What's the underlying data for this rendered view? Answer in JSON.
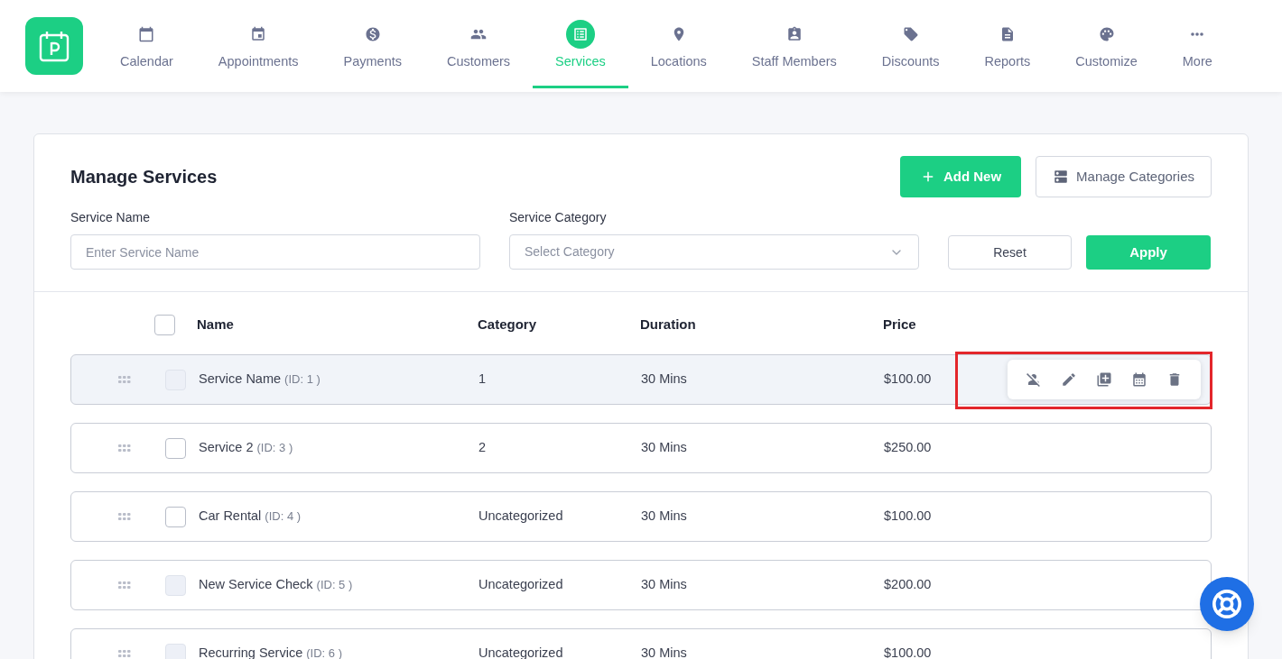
{
  "nav": {
    "items": [
      {
        "label": "Calendar",
        "selected": false
      },
      {
        "label": "Appointments",
        "selected": false
      },
      {
        "label": "Payments",
        "selected": false
      },
      {
        "label": "Customers",
        "selected": false
      },
      {
        "label": "Services",
        "selected": true
      },
      {
        "label": "Locations",
        "selected": false
      },
      {
        "label": "Staff Members",
        "selected": false
      },
      {
        "label": "Discounts",
        "selected": false
      },
      {
        "label": "Reports",
        "selected": false
      },
      {
        "label": "Customize",
        "selected": false
      },
      {
        "label": "More",
        "selected": false
      }
    ]
  },
  "panel": {
    "title": "Manage Services",
    "add_button": "Add New",
    "categories_button": "Manage Categories",
    "filters": {
      "name_label": "Service Name",
      "name_placeholder": "Enter Service Name",
      "category_label": "Service Category",
      "category_placeholder": "Select Category",
      "reset": "Reset",
      "apply": "Apply"
    },
    "table": {
      "select_all": {
        "checked": false
      },
      "columns": [
        "Name",
        "Category",
        "Duration",
        "Price"
      ],
      "rows": [
        {
          "name": "Service Name",
          "id": "(ID: 1 )",
          "category": "1",
          "duration": "30 Mins",
          "price": "$100.00",
          "disabled": true,
          "hovered": true,
          "annotated": true
        },
        {
          "name": "Service 2",
          "id": "(ID: 3 )",
          "category": "2",
          "duration": "30 Mins",
          "price": "$250.00",
          "disabled": false,
          "hovered": false,
          "annotated": false
        },
        {
          "name": "Car Rental",
          "id": "(ID: 4 )",
          "category": "Uncategorized",
          "duration": "30 Mins",
          "price": "$100.00",
          "disabled": false,
          "hovered": false,
          "annotated": false
        },
        {
          "name": "New Service Check",
          "id": "(ID: 5 )",
          "category": "Uncategorized",
          "duration": "30 Mins",
          "price": "$200.00",
          "disabled": true,
          "hovered": false,
          "annotated": false
        },
        {
          "name": "Recurring Service",
          "id": "(ID: 6 )",
          "category": "Uncategorized",
          "duration": "30 Mins",
          "price": "$100.00",
          "disabled": true,
          "hovered": false,
          "annotated": false
        }
      ]
    }
  }
}
